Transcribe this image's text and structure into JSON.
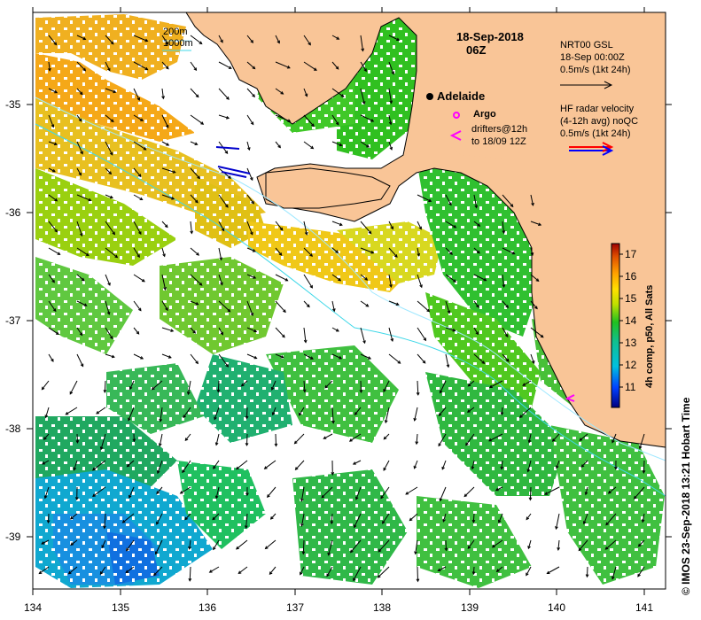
{
  "map": {
    "date": "18-Sep-2018",
    "time": "06Z",
    "city": "Adelaide",
    "x_ticks": [
      "134",
      "135",
      "136",
      "137",
      "138",
      "139",
      "140",
      "141"
    ],
    "y_ticks": [
      "-35",
      "-36",
      "-37",
      "-38",
      "-39"
    ]
  },
  "legend": {
    "isobath_200": "200m",
    "isobath_1000": "1000m",
    "argo": "Argo",
    "drifters_line1": "drifters@12h",
    "drifters_line2": "to 18/09 12Z",
    "gsl_line1": "NRT00 GSL",
    "gsl_line2": "18-Sep 00:00Z",
    "gsl_line3": "0.5m/s (1kt 24h)",
    "radar_line1": "HF radar velocity",
    "radar_line2": "(4-12h avg) noQC",
    "radar_line3": "0.5m/s (1kt 24h)"
  },
  "colorbar": {
    "label": "4h comp, p50, All Sats",
    "ticks": [
      "17",
      "16",
      "15",
      "14",
      "13",
      "12",
      "11"
    ]
  },
  "credit": "© IMOS 23-Sep-2018 13:21 Hobart Time",
  "colors": {
    "land": "#f9c597",
    "isobath_200": "#a0e8ff",
    "isobath_1000": "#40d8e8"
  }
}
